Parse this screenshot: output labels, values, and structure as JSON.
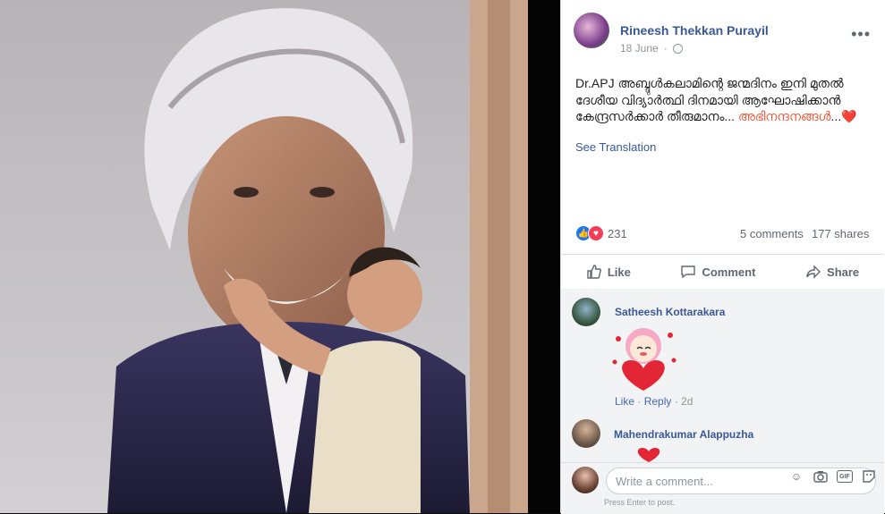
{
  "post": {
    "author": "Rineesh Thekkan Purayil",
    "date": "18 June",
    "privacy_icon": "globe-icon",
    "text_main": "Dr.APJ അബ്ദുൾകലാമിന്റെ ജന്മദിനം ഇനി മുതൽ ദേശീയ വിദ്യാർത്ഥി ദിനമായി ആഘോഷിക്കാൻ കേന്ദ്രസർക്കാർ തീരുമാനം... ",
    "text_highlight": "അഭിനന്ദനങ്ങൾ",
    "text_tail": "...❤️",
    "see_translation": "See Translation",
    "highlight_color": "#ef5c3f"
  },
  "stats": {
    "reaction_count": "231",
    "comments": "5 comments",
    "shares": "177 shares"
  },
  "actions": {
    "like": "Like",
    "comment": "Comment",
    "share": "Share"
  },
  "comments": [
    {
      "name": "Satheesh Kottarakara",
      "sticker": "heart-hug-sticker",
      "like": "Like",
      "reply": "Reply",
      "time": "2d"
    },
    {
      "name": "Mahendrakumar Alappuzha"
    }
  ],
  "composer": {
    "placeholder": "Write a comment...",
    "hint": "Press Enter to post.",
    "icons": [
      "emoji-icon",
      "camera-icon",
      "gif-icon",
      "sticker-icon"
    ]
  },
  "colors": {
    "link": "#385898",
    "like_blue": "#1877f2",
    "love_red": "#f33e58"
  }
}
